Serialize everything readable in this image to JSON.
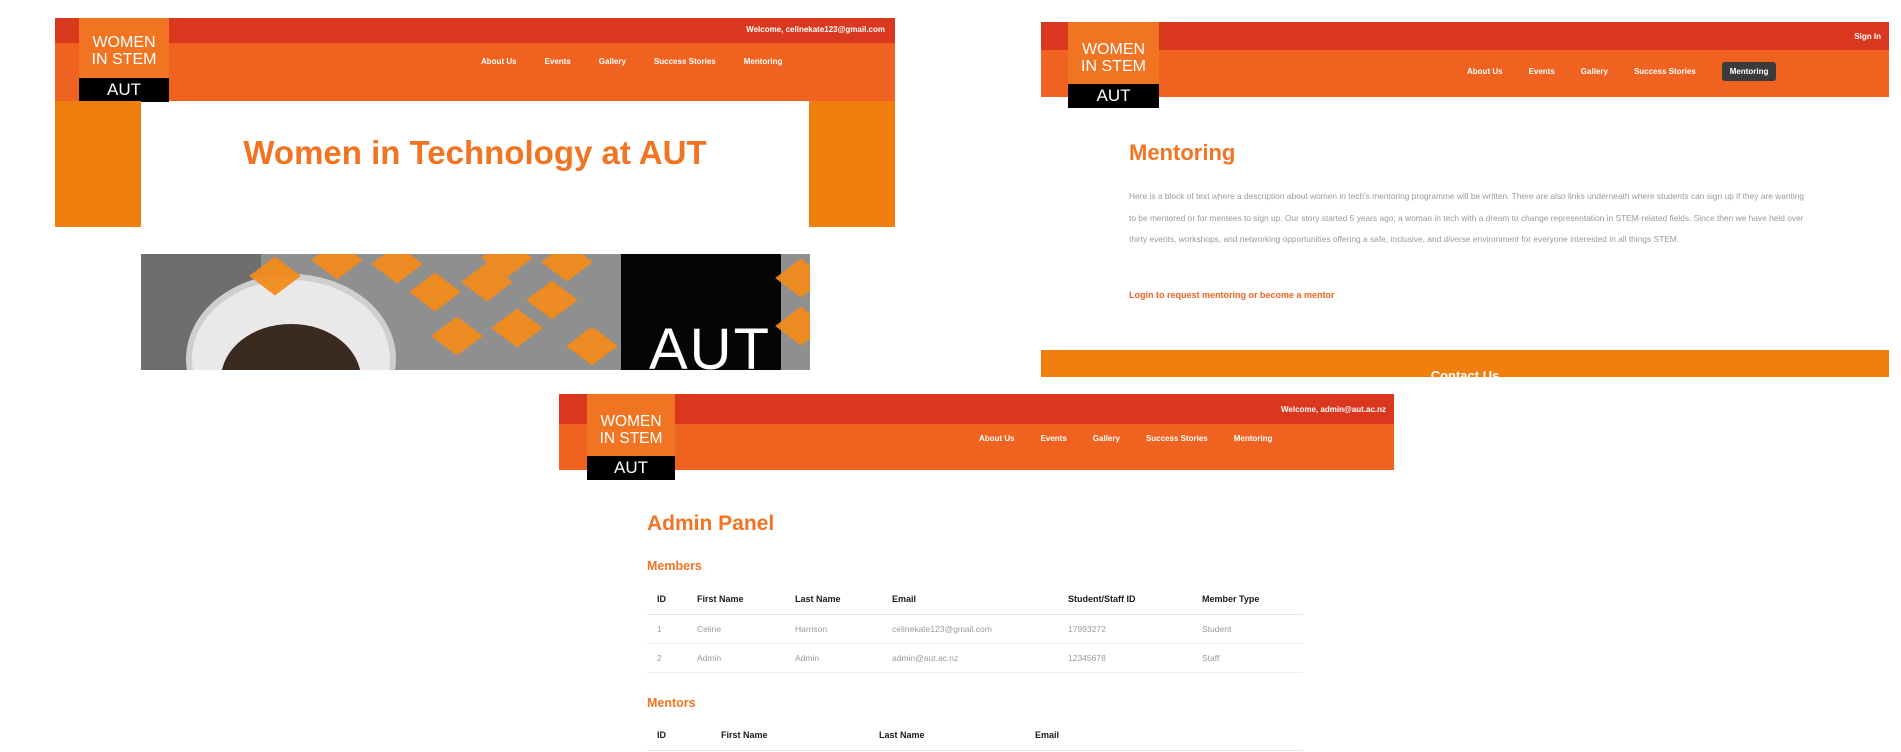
{
  "colors": {
    "accent_orange": "#f07422",
    "header_red": "#d9381e",
    "nav_orange": "#f0621f",
    "side_orange": "#f07f0f",
    "active_nav": "#3b3b3b"
  },
  "logo": {
    "line1": "WOMEN",
    "line2": "IN STEM",
    "aut": "AUT"
  },
  "nav": [
    "About Us",
    "Events",
    "Gallery",
    "Success Stories",
    "Mentoring"
  ],
  "screen1": {
    "welcome": "Welcome, celinekate123@gmail.com",
    "hero_title": "Women in Technology at AUT",
    "photo_overlay": "AUT"
  },
  "screen2": {
    "sign_in": "Sign In",
    "active_nav": "Mentoring",
    "title": "Mentoring",
    "paragraph": "Here is a block of text where a description about women in tech's mentoring programme will be written. There are also links underneath where students can sign up if they are wanting to be mentored or for mentees to sign up. Our story started 5 years ago; a woman in tech with a dream to change representation in STEM-related fields. Since then we have held over thirty events, workshops, and networking opportunities offering a safe, inclusive, and diverse environment for everyone interested in all things STEM.",
    "login_link": "Login to request mentoring or become a mentor",
    "footer_title": "Contact Us"
  },
  "screen3": {
    "welcome": "Welcome, admin@aut.ac.nz",
    "title": "Admin Panel",
    "members_title": "Members",
    "members_headers": [
      "ID",
      "First Name",
      "Last Name",
      "Email",
      "Student/Staff ID",
      "Member Type"
    ],
    "members_rows": [
      [
        "1",
        "Celine",
        "Harrison",
        "celinekate123@gmail.com",
        "17993272",
        "Student"
      ],
      [
        "2",
        "Admin",
        "Admin",
        "admin@aut.ac.nz",
        "12345678",
        "Staff"
      ]
    ],
    "mentors_title": "Mentors",
    "mentors_headers": [
      "ID",
      "First Name",
      "Last Name",
      "Email"
    ]
  }
}
